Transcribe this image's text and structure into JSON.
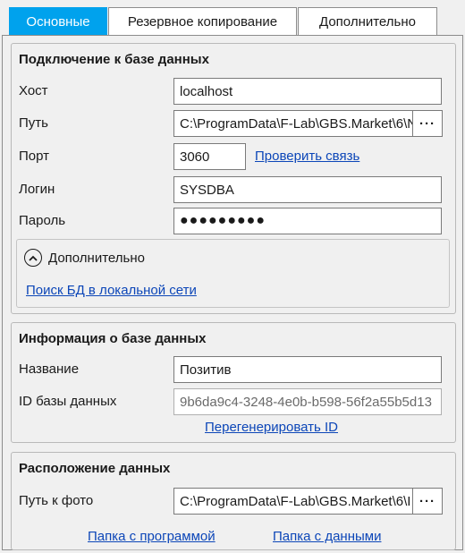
{
  "tabs": [
    {
      "label": "Основные",
      "active": true
    },
    {
      "label": "Резервное копирование",
      "active": false
    },
    {
      "label": "Дополнительно",
      "active": false
    }
  ],
  "connection": {
    "title": "Подключение к базе данных",
    "host_label": "Хост",
    "host_value": "localhost",
    "path_label": "Путь",
    "path_value": "C:\\ProgramData\\F-Lab\\GBS.Market\\6\\N",
    "path_browse": "···",
    "port_label": "Порт",
    "port_value": "3060",
    "check_link": "Проверить связь",
    "login_label": "Логин",
    "login_value": "SYSDBA",
    "password_label": "Пароль",
    "password_value": "●●●●●●●●●",
    "advanced": {
      "expander_label": "Дополнительно",
      "expanded": true,
      "search_link": "Поиск БД в локальной сети"
    }
  },
  "db_info": {
    "title": "Информация о базе данных",
    "name_label": "Название",
    "name_value": "Позитив",
    "id_label": "ID базы данных",
    "id_value": "9b6da9c4-3248-4e0b-b598-56f2a55b5d13",
    "regen_link": "Перегенерировать ID"
  },
  "data_location": {
    "title": "Расположение данных",
    "photo_label": "Путь к фото",
    "photo_value": "C:\\ProgramData\\F-Lab\\GBS.Market\\6\\I",
    "photo_browse": "···",
    "program_folder_link": "Папка с программой",
    "data_folder_link": "Папка с данными"
  },
  "colors": {
    "accent": "#00a2ed",
    "link": "#0c46b8"
  }
}
